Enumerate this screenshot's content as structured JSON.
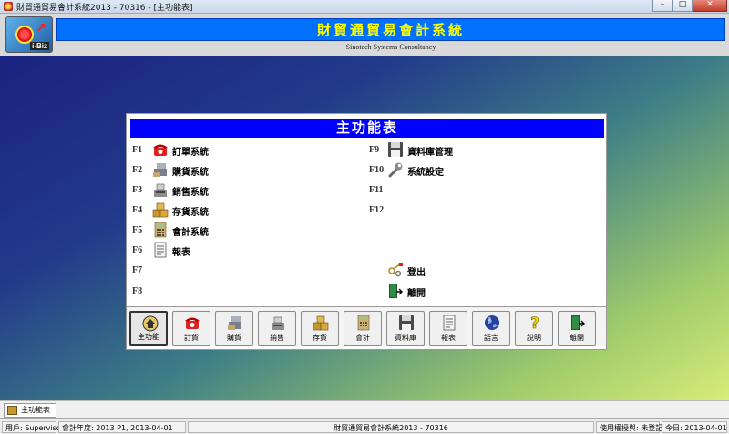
{
  "window": {
    "title": "財貿通貿易會計系統2013 - 70316 - [主功能表]",
    "min": "–",
    "max": "□",
    "close": "✕"
  },
  "header": {
    "app_name": "財貿通貿易會計系統",
    "company": "Sinotech Systems Consultancy",
    "logo_tag": "i-Biz"
  },
  "menu": {
    "title": "主功能表",
    "left_items": [
      {
        "key": "F1",
        "label": "訂單系統",
        "icon": "telephone-icon"
      },
      {
        "key": "F2",
        "label": "購貨系統",
        "icon": "cash-register-icon"
      },
      {
        "key": "F3",
        "label": "銷售系統",
        "icon": "register-scale-icon"
      },
      {
        "key": "F4",
        "label": "存貨系統",
        "icon": "boxes-icon"
      },
      {
        "key": "F5",
        "label": "會計系統",
        "icon": "calculator-icon"
      },
      {
        "key": "F6",
        "label": "報表",
        "icon": "report-icon"
      },
      {
        "key": "F7",
        "label": "",
        "icon": ""
      },
      {
        "key": "F8",
        "label": "",
        "icon": ""
      }
    ],
    "right_items": [
      {
        "key": "F9",
        "label": "資料庫管理",
        "icon": "floppy-disk-icon"
      },
      {
        "key": "F10",
        "label": "系統設定",
        "icon": "wrench-icon"
      },
      {
        "key": "F11",
        "label": "",
        "icon": ""
      },
      {
        "key": "F12",
        "label": "",
        "icon": ""
      }
    ],
    "logout_label": "登出",
    "exit_label": "離開"
  },
  "toolbar": {
    "buttons": [
      {
        "label": "主功能",
        "icon": "home-icon",
        "active": true
      },
      {
        "label": "訂貨",
        "icon": "telephone-icon",
        "active": false
      },
      {
        "label": "購貨",
        "icon": "cash-register-icon",
        "active": false
      },
      {
        "label": "銷售",
        "icon": "register-scale-icon",
        "active": false
      },
      {
        "label": "存貨",
        "icon": "boxes-icon",
        "active": false
      },
      {
        "label": "會計",
        "icon": "calculator-icon",
        "active": false
      },
      {
        "label": "資料庫",
        "icon": "floppy-disk-icon",
        "active": false
      },
      {
        "label": "報表",
        "icon": "report-icon",
        "active": false
      },
      {
        "label": "語言",
        "icon": "globe-icon",
        "active": false
      },
      {
        "label": "說明",
        "icon": "help-icon",
        "active": false
      },
      {
        "label": "離開",
        "icon": "exit-door-icon",
        "active": false
      }
    ]
  },
  "tabs": [
    {
      "label": "主功能表"
    }
  ],
  "status": {
    "user": "用戶: Supervisor",
    "period": "會計年度: 2013 P1, 2013-04-01",
    "product": "財貿通貿易會計系統2013 - 70316",
    "license": "使用權授與: 未登記",
    "today": "今日: 2013-04-01"
  },
  "colors": {
    "header_blue": "#0070ff",
    "app_name_yellow": "#ffff00",
    "panel_title_blue": "#0000ff"
  }
}
